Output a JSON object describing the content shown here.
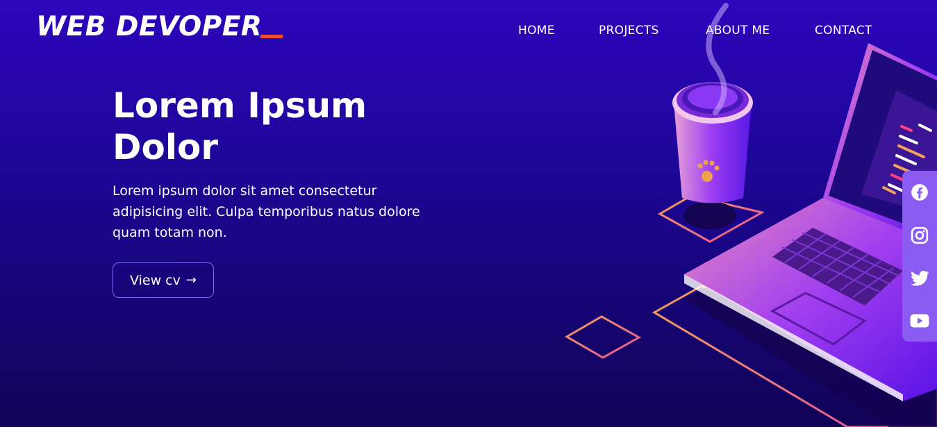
{
  "header": {
    "logo_text": "WEB DEVOPER",
    "nav": [
      {
        "label": "HOME"
      },
      {
        "label": "PROJECTS"
      },
      {
        "label": "ABOUT ME"
      },
      {
        "label": "CONTACT"
      }
    ]
  },
  "hero": {
    "title": "Lorem Ipsum Dolor",
    "description": "Lorem ipsum dolor sit amet consectetur adipisicing elit. Culpa temporibus natus dolore quam totam non.",
    "cv_button": "View cv",
    "cv_arrow": "→"
  },
  "social": [
    {
      "icon": "facebook-icon"
    },
    {
      "icon": "instagram-icon"
    },
    {
      "icon": "twitter-icon"
    },
    {
      "icon": "youtube-icon"
    }
  ],
  "colors": {
    "background_top": "#2c06bc",
    "background_bottom": "#110456",
    "accent": "#f24d2e",
    "social_bar": "#8a5cf2",
    "button_border": "#7a6bff"
  }
}
